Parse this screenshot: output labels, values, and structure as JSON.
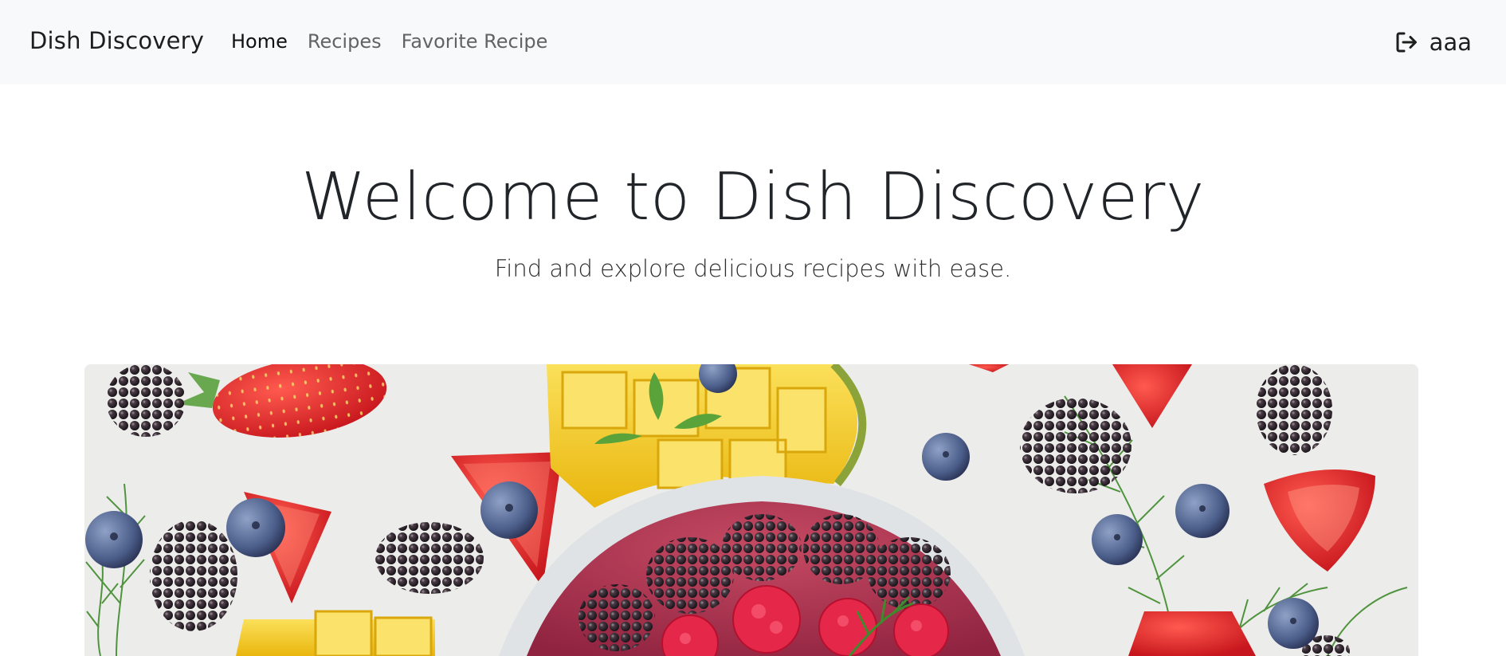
{
  "navbar": {
    "brand": "Dish Discovery",
    "links": [
      {
        "label": "Home",
        "active": true
      },
      {
        "label": "Recipes",
        "active": false
      },
      {
        "label": "Favorite Recipe",
        "active": false
      }
    ],
    "user": {
      "icon": "logout-icon",
      "name": "aaa"
    }
  },
  "hero": {
    "title": "Welcome to Dish Discovery",
    "subtitle": "Find and explore delicious recipes with ease."
  },
  "banner": {
    "subject": "fruit bowl with berries, strawberries, mango and dill",
    "colors": {
      "background": "#ececea",
      "strawberry": "#e0322f",
      "blackberry": "#1f1a1f",
      "blueberry": "#4b5e8a",
      "mango": "#f2c417",
      "dill": "#3f8a2c",
      "bowl": "#dfe3e6",
      "smoothie": "#b0304c",
      "raspberry": "#e5284a"
    }
  }
}
